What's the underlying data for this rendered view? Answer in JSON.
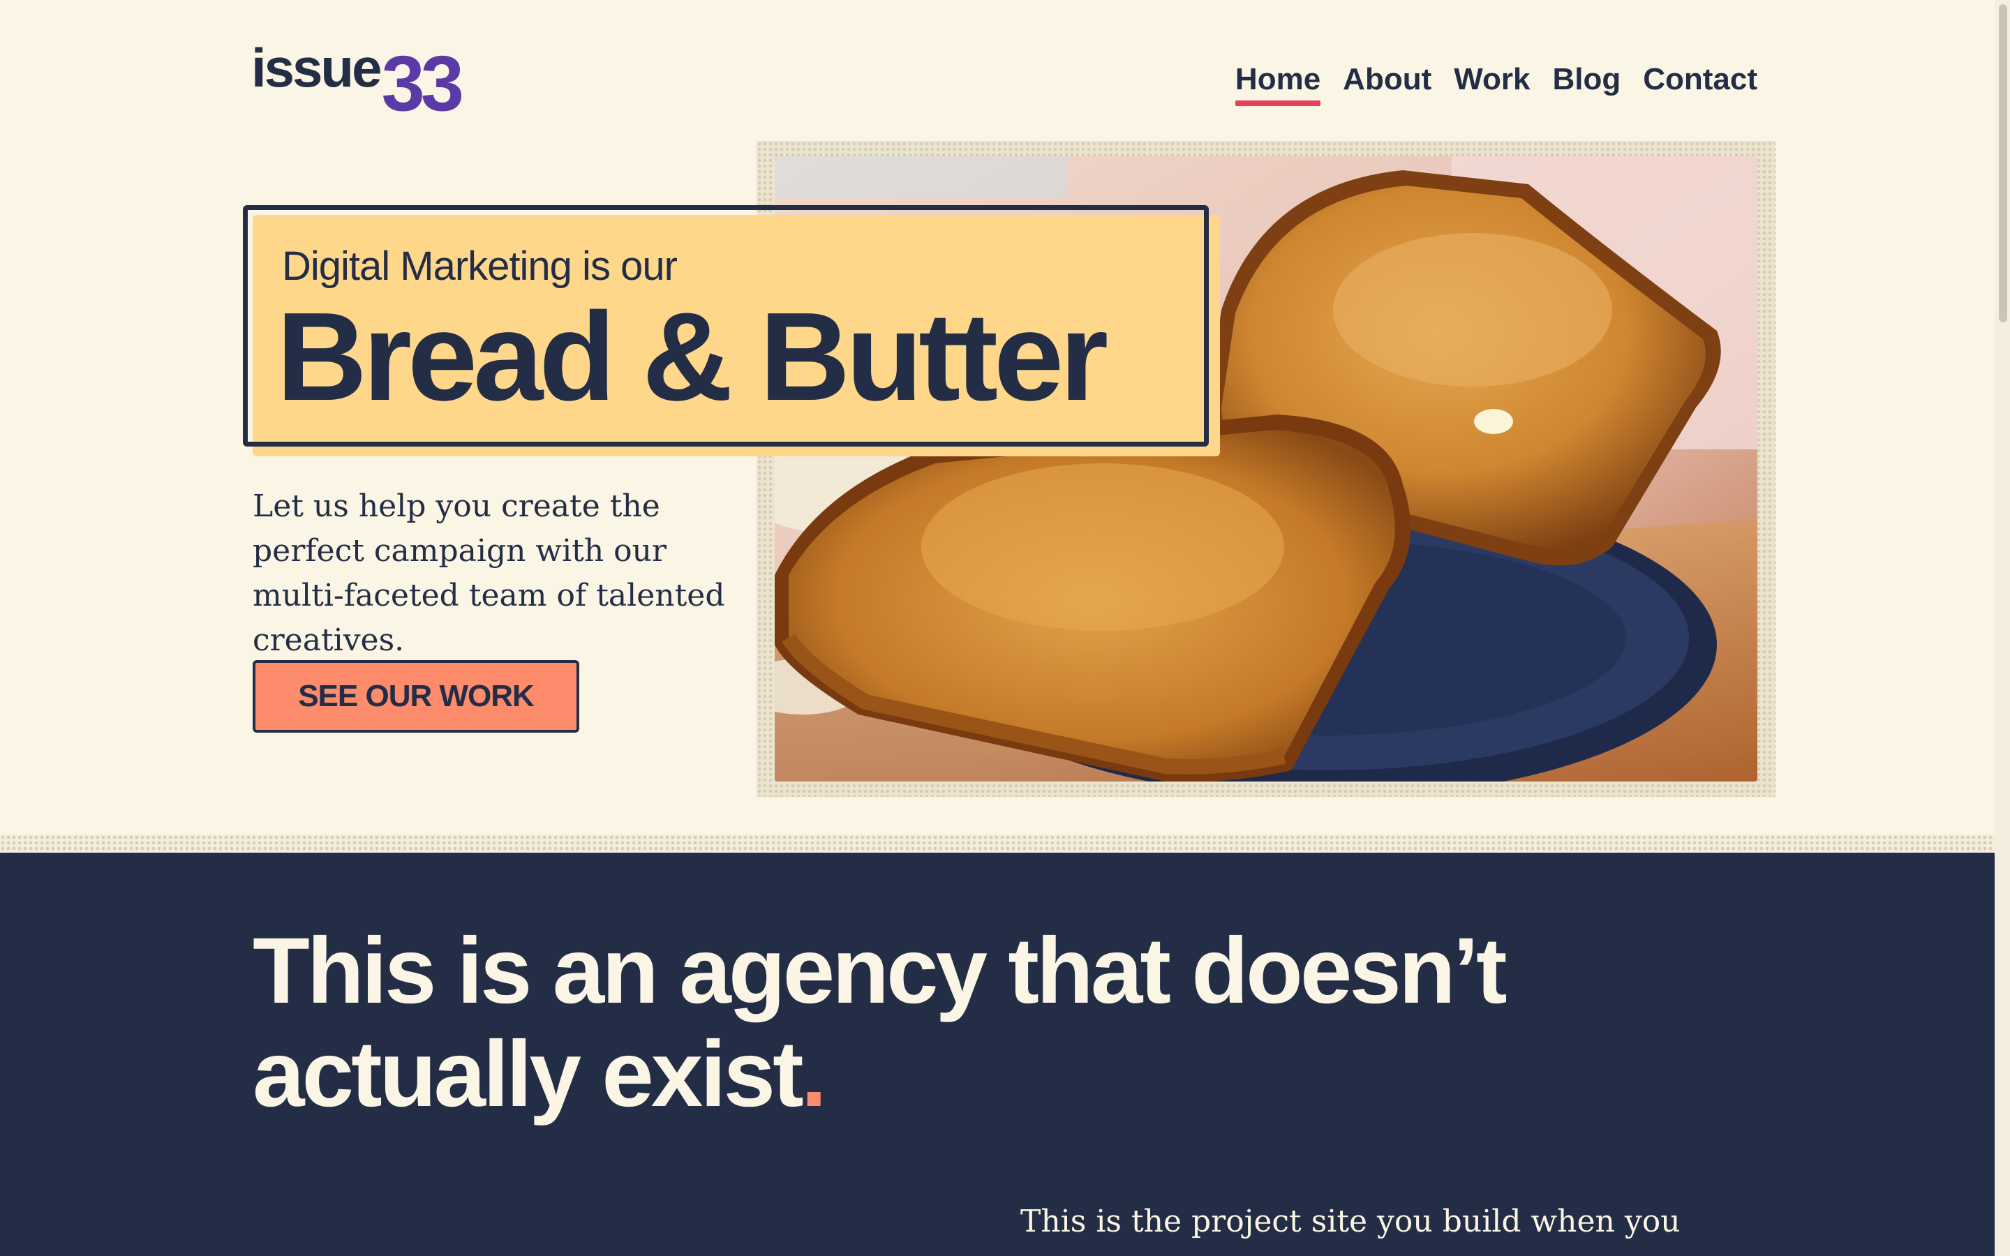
{
  "logo": {
    "word": "issue",
    "number": "33"
  },
  "nav": {
    "items": [
      {
        "label": "Home",
        "active": true
      },
      {
        "label": "About"
      },
      {
        "label": "Work"
      },
      {
        "label": "Blog"
      },
      {
        "label": "Contact"
      }
    ]
  },
  "hero": {
    "kicker": "Digital Marketing is our",
    "headline": "Bread & Butter",
    "body": "Let us help you create the perfect campaign with our multi-faceted team of talented creatives.",
    "cta_label": "SEE OUR WORK",
    "image_icon": "toast-on-plate-photo"
  },
  "about": {
    "heading": "This is an agency that doesn’t actually exist",
    "heading_dot": ".",
    "body": "This is the project site you build when you"
  },
  "colors": {
    "background": "#faf5e4",
    "navy": "#232d45",
    "accent_pink": "#e8405a",
    "accent_purple": "#5b3aa8",
    "highlight_yellow": "#fed78a",
    "button_coral": "#fc8c6c"
  }
}
